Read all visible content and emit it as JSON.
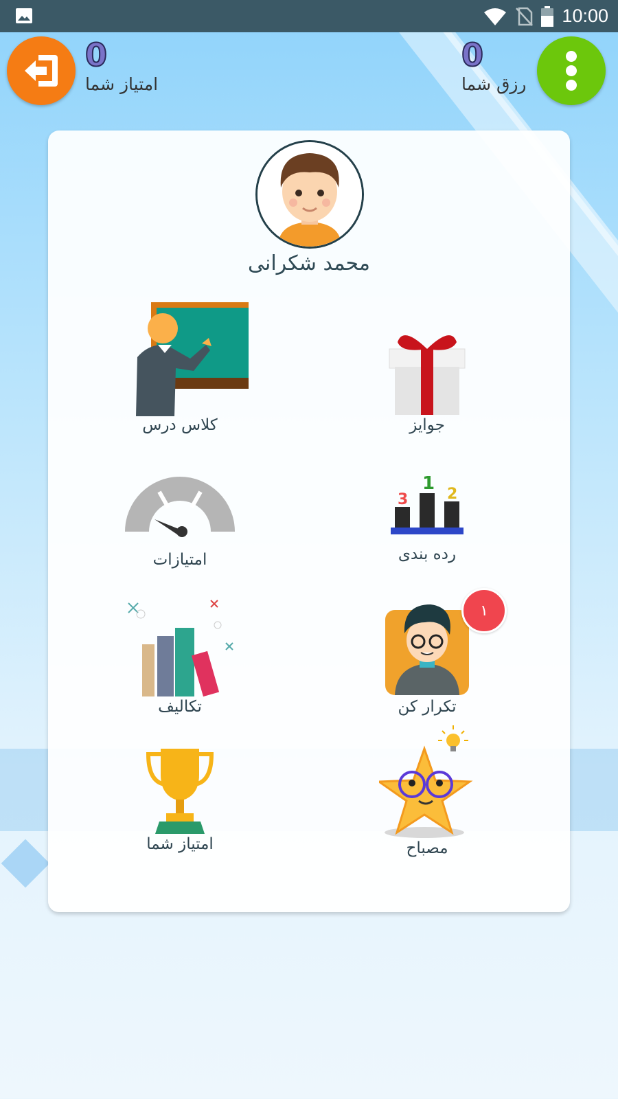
{
  "status_bar": {
    "time": "10:00"
  },
  "header": {
    "left_score": {
      "value": "0",
      "label": "امتیاز شما"
    },
    "right_score": {
      "value": "0",
      "label": "رزق شما"
    }
  },
  "profile": {
    "name": "محمد شکرانی"
  },
  "tiles": {
    "classroom": "کلاس درس",
    "prizes": "جوایز",
    "points": "امتیازات",
    "ranking": "رده بندی",
    "homework": "تکالیف",
    "repeat": "تکرار کن",
    "repeat_badge": "۱",
    "your_score": "امتیاز شما",
    "mesbah": "مصباح"
  },
  "colors": {
    "statusbar": "#3b5966",
    "logout": "#f57c14",
    "menu": "#6cc70c",
    "badge": "#f0454e"
  }
}
